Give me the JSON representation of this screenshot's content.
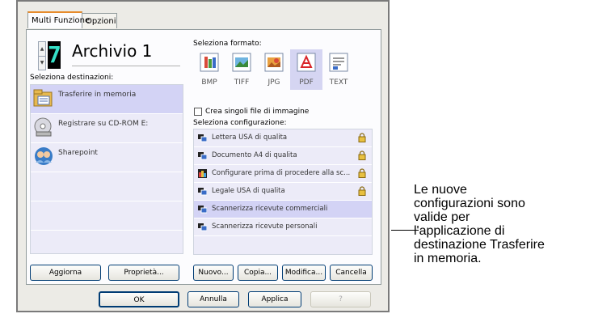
{
  "tabs": [
    {
      "label": "Multi Funzione",
      "active": true
    },
    {
      "label": "Opzioni",
      "active": false
    }
  ],
  "profile": {
    "digit": "7",
    "name": "Archivio 1"
  },
  "destinations": {
    "label": "Seleziona destinazioni:",
    "items": [
      {
        "label": "Trasferire in memoria",
        "selected": true,
        "icon": "memory-transfer-icon"
      },
      {
        "label": "Registrare su CD-ROM  E:",
        "selected": false,
        "icon": "cd-rom-icon"
      },
      {
        "label": "Sharepoint",
        "selected": false,
        "icon": "sharepoint-icon"
      }
    ]
  },
  "format": {
    "label": "Seleziona formato:",
    "items": [
      {
        "label": "BMP",
        "selected": false
      },
      {
        "label": "TIFF",
        "selected": false
      },
      {
        "label": "JPG",
        "selected": false
      },
      {
        "label": "PDF",
        "selected": true
      },
      {
        "label": "TEXT",
        "selected": false
      }
    ],
    "single_files_label": "Crea singoli file di immagine"
  },
  "configurations": {
    "label": "Seleziona configurazione:",
    "items": [
      {
        "label": "Lettera USA di qualita",
        "locked": true,
        "selected": false
      },
      {
        "label": "Documento A4 di qualita",
        "locked": true,
        "selected": false
      },
      {
        "label": "Configurare prima di procedere alla sc...",
        "locked": true,
        "selected": false
      },
      {
        "label": "Legale USA di qualita",
        "locked": true,
        "selected": false
      },
      {
        "label": "Scannerizza ricevute commerciali",
        "locked": false,
        "selected": true
      },
      {
        "label": "Scannerizza ricevute personali",
        "locked": false,
        "selected": false
      }
    ]
  },
  "buttons": {
    "aggiorna": "Aggiorna",
    "proprieta": "Proprietà...",
    "nuovo": "Nuovo...",
    "copia": "Copia...",
    "modifica": "Modifica...",
    "cancella": "Cancella",
    "ok": "OK",
    "annulla": "Annulla",
    "applica": "Applica",
    "help": "?"
  },
  "callout": {
    "lines": [
      "Le nuove",
      "configurazioni sono",
      "valide per",
      "l'applicazione di",
      "destinazione Trasferire",
      "in memoria."
    ]
  },
  "colors": {
    "accent_tab": "#e68b2c",
    "selection": "#d3d3f5",
    "digit": "#36e0c8"
  }
}
